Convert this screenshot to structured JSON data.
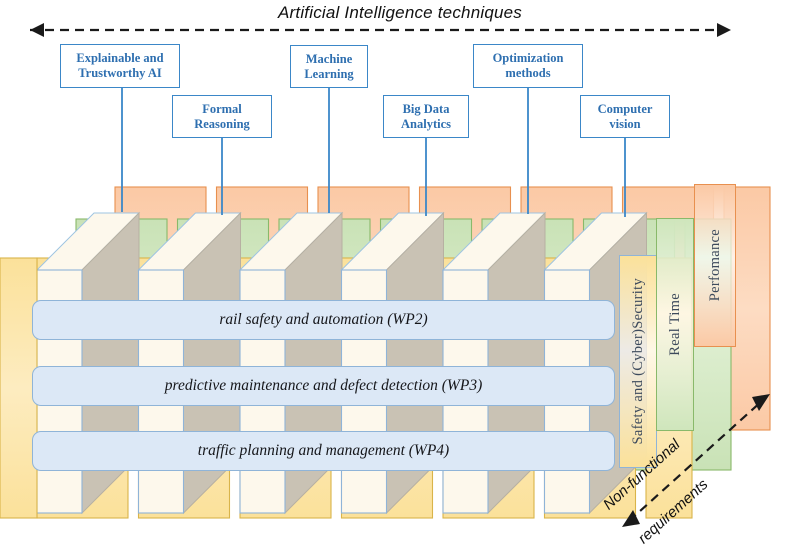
{
  "figure": {
    "top_axis_label": "Artificial Intelligence techniques",
    "diagonal_axis_label_line1": "Non-functional",
    "diagonal_axis_label_line2": "requirements"
  },
  "ai_techniques": [
    {
      "id": "explainable-trustworthy-ai",
      "line1": "Explainable  and",
      "line2": "Trustworthy  AI"
    },
    {
      "id": "formal-reasoning",
      "line1": "Formal",
      "line2": "Reasoning"
    },
    {
      "id": "machine-learning",
      "line1": "Machine",
      "line2": "Learning"
    },
    {
      "id": "big-data-analytics",
      "line1": "Big Data",
      "line2": "Analytics"
    },
    {
      "id": "optimization-methods",
      "line1": "Optimization",
      "line2": "methods"
    },
    {
      "id": "computer-vision",
      "line1": "Computer",
      "line2": "vision"
    }
  ],
  "work_packages": [
    {
      "id": "wp2",
      "label": "rail safety and automation (WP2)"
    },
    {
      "id": "wp3",
      "label": "predictive maintenance and defect detection (WP3)"
    },
    {
      "id": "wp4",
      "label": "traffic planning and management (WP4)"
    }
  ],
  "non_functional_requirements": [
    {
      "id": "safety-cyber-security",
      "label": "Safety and (Cyber)Security",
      "color": "#fbdf92"
    },
    {
      "id": "real-time",
      "label": "Real Time",
      "color": "#c6e0b4"
    },
    {
      "id": "performance",
      "label": "Perfomance",
      "color": "#fbc9a5"
    }
  ],
  "colors": {
    "box_border": "#3b87c8",
    "box_text": "#2e6fb0",
    "wp_fill": "#dce8f6",
    "wp_border": "#8fb4d8",
    "slab_front": "#fdf8ec",
    "slab_side": "#c9c2b4",
    "slab_top": "#fdf8ec",
    "layer_yellow": "#fbdf92",
    "layer_green": "#c6e0b4",
    "layer_orange": "#fbc9a5",
    "arrow": "#1a1a1a"
  }
}
